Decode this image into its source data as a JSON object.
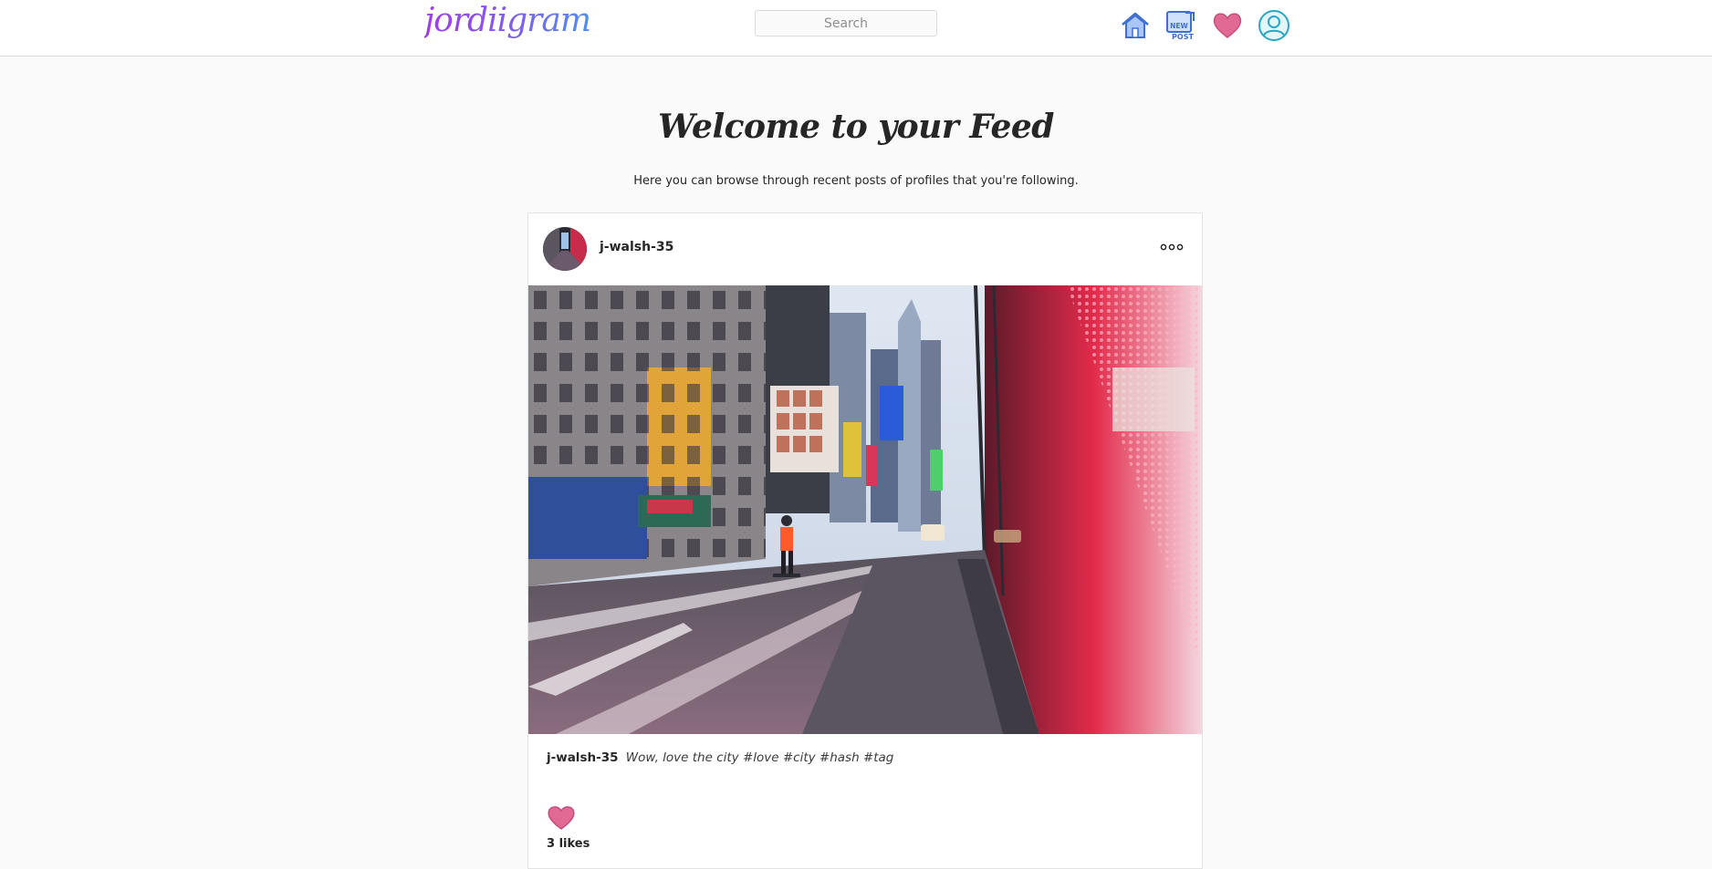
{
  "header": {
    "logo": "jordiigram",
    "search_placeholder": "Search",
    "nav_icons": [
      "home-icon",
      "new-post-icon",
      "heart-icon",
      "profile-icon"
    ],
    "new_post_icon_text": "NEW POST"
  },
  "feed": {
    "title": "Welcome to your Feed",
    "subtitle": "Here you can browse through recent posts of profiles that you're following."
  },
  "post": {
    "username": "j-walsh-35",
    "caption_user": "j-walsh-35",
    "caption": "Wow, love the city #love #city #hash #tag",
    "likes": "3 likes",
    "menu_icon": "more-options-icon"
  },
  "colors": {
    "heart": "#e06a94",
    "icon_blue": "#5b8def",
    "logo_gradient": [
      "#a33be6",
      "#4c8ff5"
    ]
  }
}
